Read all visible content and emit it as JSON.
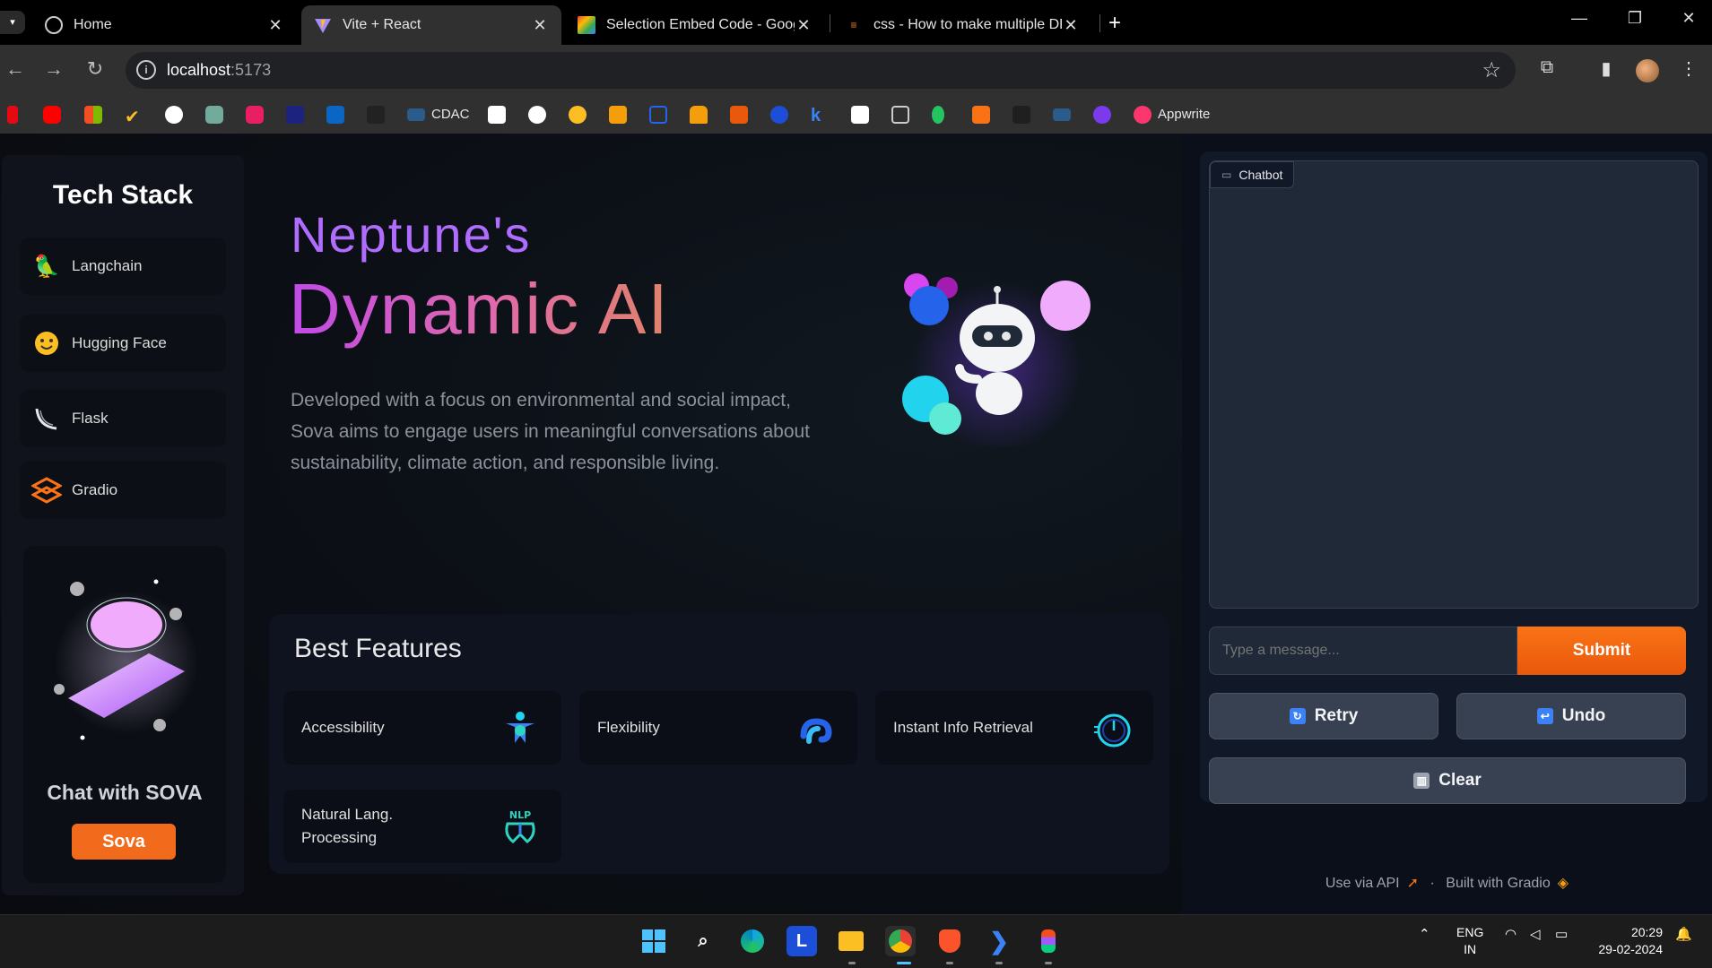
{
  "browser": {
    "tabs": [
      {
        "title": "Home",
        "active": false
      },
      {
        "title": "Vite + React",
        "active": true
      },
      {
        "title": "Selection Embed Code - Google",
        "active": false
      },
      {
        "title": "css - How to make multiple DRO",
        "active": false
      }
    ],
    "url_host": "localhost",
    "url_port": ":5173",
    "bookmarks": {
      "cdac_label": "CDAC",
      "appwrite_label": "Appwrite"
    }
  },
  "sidebar": {
    "title": "Tech Stack",
    "items": [
      {
        "label": "Langchain",
        "icon": "parrot-link-icon"
      },
      {
        "label": "Hugging Face",
        "icon": "hugging-face-icon"
      },
      {
        "label": "Flask",
        "icon": "flask-horn-icon"
      },
      {
        "label": "Gradio",
        "icon": "gradio-icon"
      }
    ],
    "card": {
      "title": "Chat with SOVA",
      "button": "Sova"
    }
  },
  "hero": {
    "kicker": "Neptune's",
    "title": "Dynamic AI",
    "description": "Developed with a focus on environmental and social impact, Sova aims to engage users in meaningful conversations about sustainability, climate action, and responsible living."
  },
  "features": {
    "title": "Best Features",
    "items": [
      {
        "label": "Accessibility",
        "icon": "accessibility-icon"
      },
      {
        "label": "Flexibility",
        "icon": "flexibility-icon"
      },
      {
        "label": "Instant Info Retrieval",
        "icon": "stopwatch-icon"
      },
      {
        "label": "Natural Lang. Processing",
        "icon": "nlp-icon"
      }
    ]
  },
  "gradio": {
    "chatbot_label": "Chatbot",
    "input_placeholder": "Type a message...",
    "submit": "Submit",
    "retry": "Retry",
    "undo": "Undo",
    "clear": "Clear",
    "footer_api": "Use via API",
    "footer_sep": "·",
    "footer_built": "Built with Gradio"
  },
  "taskbar": {
    "lang_line1": "ENG",
    "lang_line2": "IN",
    "time": "20:29",
    "date": "29-02-2024"
  },
  "colors": {
    "accent_orange": "#f26a1b",
    "hero_kicker": "#b06cff",
    "gradio_bg": "#0b0f19"
  }
}
